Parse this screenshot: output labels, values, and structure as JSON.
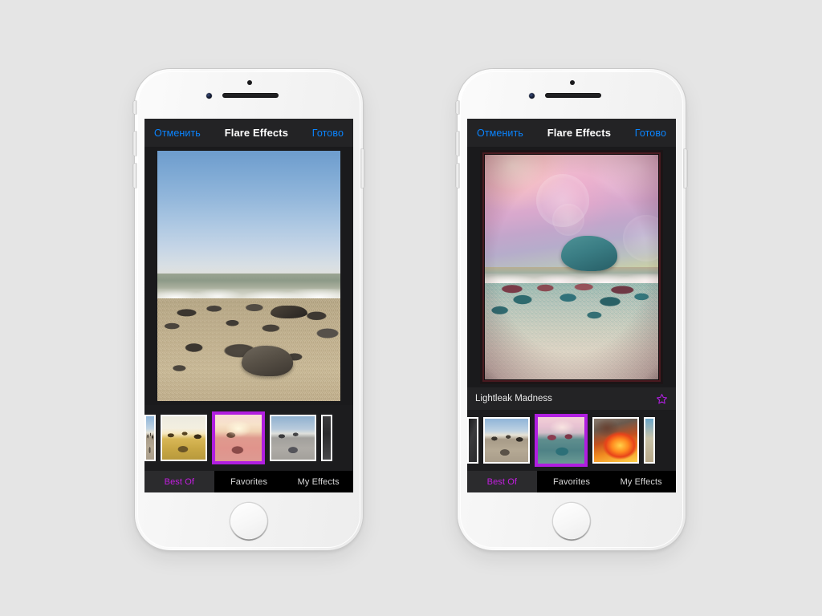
{
  "page": {
    "background_color": "#e5e5e5",
    "accent_magenta": "#b01ee0",
    "accent_blue": "#0a84ff"
  },
  "phones": [
    {
      "id": "phone-left",
      "navbar": {
        "cancel_label": "Отменить",
        "title": "Flare Effects",
        "done_label": "Готово"
      },
      "photo": {
        "description": "original-beach-photo",
        "has_caption": false
      },
      "thumbnails": [
        {
          "name": "thumb-edge-left",
          "style": "tm-beach",
          "selected": false,
          "edge": true
        },
        {
          "name": "thumb-golden",
          "style": "tm-golden",
          "selected": false,
          "edge": false
        },
        {
          "name": "thumb-pink-flare",
          "style": "tm-pinkflare",
          "selected": true,
          "edge": false
        },
        {
          "name": "thumb-blue-gray",
          "style": "tm-bluegray",
          "selected": false,
          "edge": false
        },
        {
          "name": "thumb-edge-right",
          "style": "tm-dark",
          "selected": false,
          "edge": true
        }
      ],
      "tabs": [
        {
          "label": "Best Of",
          "active": true
        },
        {
          "label": "Favorites",
          "active": false
        },
        {
          "label": "My Effects",
          "active": false
        }
      ]
    },
    {
      "id": "phone-right",
      "navbar": {
        "cancel_label": "Отменить",
        "title": "Flare Effects",
        "done_label": "Готово"
      },
      "photo": {
        "description": "lightleak-processed-photo",
        "has_caption": true
      },
      "caption": {
        "effect_name": "Lightleak Madness",
        "favorite_icon": "star-outline-icon",
        "favorite_active": false
      },
      "thumbnails": [
        {
          "name": "thumb-edge-left",
          "style": "tm-darkleft",
          "selected": false,
          "edge": true
        },
        {
          "name": "thumb-original",
          "style": "tm-beach",
          "selected": false,
          "edge": false
        },
        {
          "name": "thumb-lightleak",
          "style": "tm-teal",
          "selected": true,
          "edge": false
        },
        {
          "name": "thumb-fire",
          "style": "tm-fire",
          "selected": false,
          "edge": false
        },
        {
          "name": "thumb-edge-right",
          "style": "tm-tealedge",
          "selected": false,
          "edge": true
        }
      ],
      "tabs": [
        {
          "label": "Best Of",
          "active": true
        },
        {
          "label": "Favorites",
          "active": false
        },
        {
          "label": "My Effects",
          "active": false
        }
      ]
    }
  ],
  "hardware": {
    "front_camera": "front-camera-icon",
    "proximity_sensor": "proximity-sensor-icon",
    "earpiece": "earpiece-speaker",
    "home_button": "home-button",
    "silence_switch": "silence-switch",
    "volume_down": "volume-down-button",
    "volume_up": "volume-up-button",
    "power": "power-button"
  }
}
